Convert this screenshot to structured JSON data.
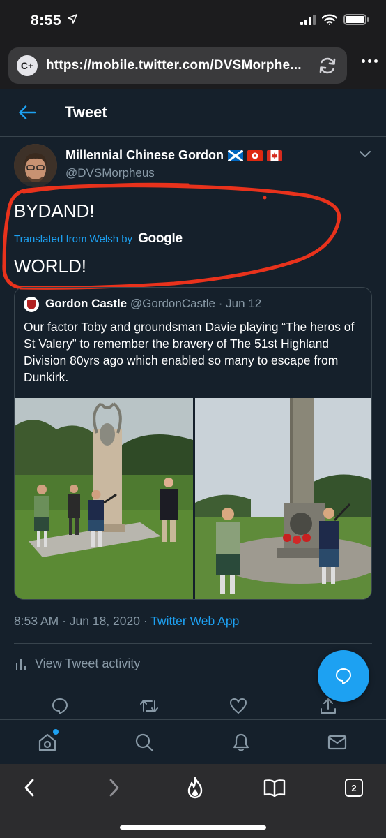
{
  "status_bar": {
    "time": "8:55"
  },
  "browser": {
    "icon_label": "C+",
    "url": "https://mobile.twitter.com/DVSMorphe...",
    "tab_count": "2"
  },
  "header": {
    "title": "Tweet"
  },
  "tweet": {
    "author_name": "Millennial Chinese Gordon",
    "author_flags": [
      "scotland-flag",
      "hong-kong-flag",
      "canada-flag"
    ],
    "author_handle": "@DVSMorpheus",
    "text_line1": "BYDAND!",
    "translated_label": "Translated from Welsh by",
    "translator": "Google",
    "text_line2": "WORLD!",
    "timestamp": "8:53 AM · Jun 18, 2020 · ",
    "source": "Twitter Web App",
    "activity_label": "View Tweet activity"
  },
  "quote": {
    "name": "Gordon Castle",
    "handle": "@GordonCastle",
    "date": " · Jun 12",
    "text": "Our factor Toby and groundsman Davie playing “The heros of St Valery” to remember the bravery of The 51st Highland Division 80yrs ago which enabled so many to escape from Dunkirk."
  },
  "colors": {
    "background": "#15202b",
    "accent": "#1da1f2",
    "muted": "#8899a6",
    "border": "#38444d",
    "annotation": "#e8321c"
  }
}
